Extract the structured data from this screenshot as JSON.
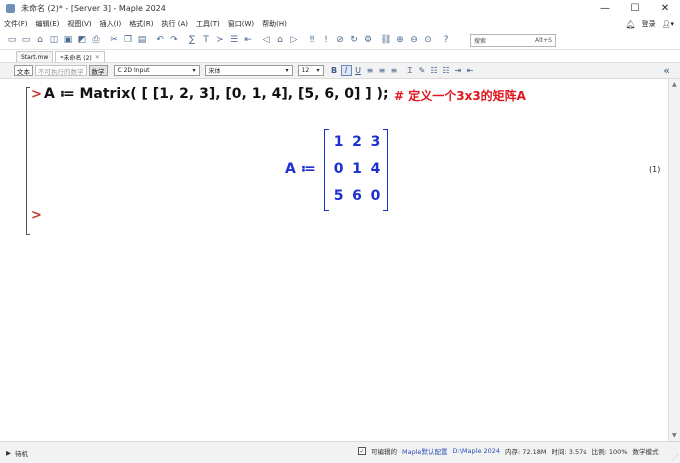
{
  "window": {
    "title": "未命名 (2)* - [Server 3] - Maple 2024",
    "controls": {
      "minimize": "—",
      "maximize": "☐",
      "close": "✕"
    }
  },
  "menu": {
    "items": [
      "文件(F)",
      "编辑(E)",
      "视图(V)",
      "插入(I)",
      "格式(R)",
      "执行 (A)",
      "工具(T)",
      "窗口(W)",
      "帮助(H)"
    ],
    "login": "登录",
    "icons": {
      "bell": "bell-icon",
      "user": "user-icon"
    }
  },
  "toolbar": {
    "search_placeholder": "搜索",
    "search_shortcut": "Alt+S"
  },
  "tabs": [
    {
      "label": "Start.mw",
      "active": false
    },
    {
      "label": "*未命名 (2)",
      "active": true
    }
  ],
  "context_bar": {
    "text_button": "文本",
    "nonexec_button": "不可执行的数学",
    "math_button": "数学",
    "style_select": "C 2D Input",
    "font_select": "宋体",
    "size_select": "12",
    "bold": "B",
    "italic": "I",
    "underline": "U"
  },
  "worksheet": {
    "prompt_symbol": ">",
    "input_command": "A ≔ Matrix( [ [1, 2, 3], [0, 1, 4], [5, 6, 0] ] );",
    "comment": "# 定义一个3x3的矩阵A",
    "output_lhs": "A ≔",
    "matrix_rows": [
      [
        "1",
        "2",
        "3"
      ],
      [
        "0",
        "1",
        "4"
      ],
      [
        "5",
        "6",
        "0"
      ]
    ],
    "equation_label": "(1)"
  },
  "statusbar": {
    "state": "待机",
    "editable_label": "可编辑的",
    "editable_checked": true,
    "config": "Maple默认配置",
    "path": "D:\\Maple 2024",
    "memory": "内存: 72.18M",
    "time": "时间: 3.57s",
    "zoom": "比例: 100%",
    "mode": "数学模式"
  },
  "colors": {
    "prompt": "#c0392b",
    "output": "#1d2fd1",
    "comment": "#e0151e"
  }
}
